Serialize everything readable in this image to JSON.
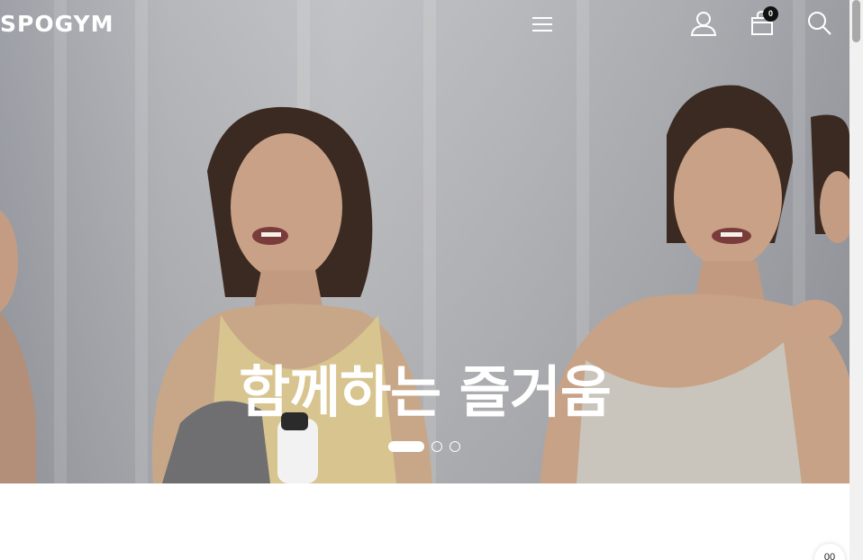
{
  "header": {
    "logo_text": "SPOGYM",
    "cart_count": "0",
    "icons": [
      "menu-icon",
      "user-icon",
      "shopping-bag-icon",
      "search-icon"
    ]
  },
  "hero": {
    "title": "함께하는 즐거움",
    "slides_total": 3,
    "active_slide": 1
  },
  "floating": {
    "corner_label": "00"
  },
  "colors": {
    "overlay_text": "#ffffff",
    "badge_bg": "#111111",
    "scroll_track": "#f1f1f1"
  }
}
